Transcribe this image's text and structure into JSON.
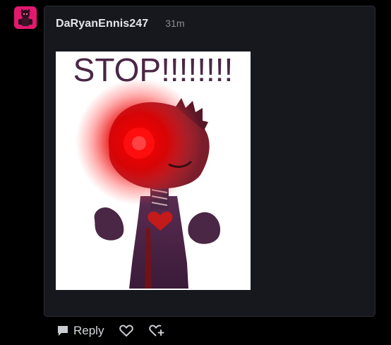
{
  "post": {
    "username": "DaRyanEnnis247",
    "timestamp": "31m",
    "image_text": "STOP!!!!!!!!"
  },
  "actions": {
    "reply_label": "Reply"
  },
  "colors": {
    "page_background": "#000000",
    "card_background": "#16181d",
    "card_border": "#2a2d33",
    "username": "#e4e6ea",
    "timestamp": "#8b8f97",
    "avatar_accent": "#e3196e",
    "image_glow": "#ff0000",
    "figure": "#4a2745"
  },
  "icons": {
    "reply": "speech-bubble-icon",
    "like": "heart-icon",
    "repost": "heart-repost-icon"
  }
}
